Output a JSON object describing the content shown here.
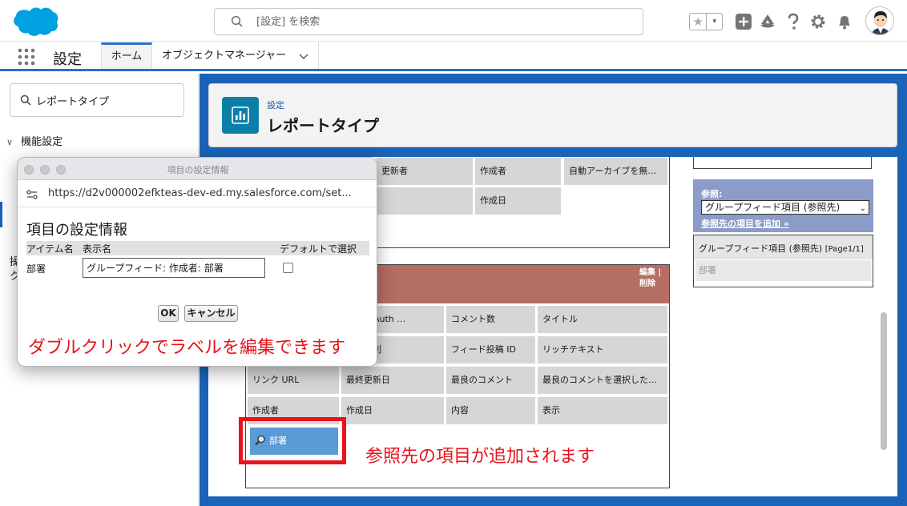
{
  "header": {
    "search_placeholder": "[設定] を検索",
    "fav_star": "★",
    "fav_caret": "▾"
  },
  "context_bar": {
    "app_name": "設定",
    "tabs": [
      {
        "label": "ホーム"
      },
      {
        "label": "オブジェクトマネージャー"
      }
    ]
  },
  "left_nav": {
    "search_value": "レポートタイプ",
    "section": "機能設定",
    "section_arrow": "∨",
    "stub_1": "操",
    "stub_2": "ク"
  },
  "page_header": {
    "breadcrumb": "設定",
    "title": "レポートタイプ"
  },
  "upper_table": {
    "cells": [
      {
        "label": "更新者"
      },
      {
        "label": "作成者"
      },
      {
        "label": "自動アーカイブを無効化"
      },
      {
        "label": "作成日"
      }
    ]
  },
  "lower_table": {
    "actions": "編集 | 削除",
    "rows": [
      [
        "ント OAuth …",
        "コメント数",
        "タイトル"
      ],
      [
        "項目種別",
        "フィード投稿 ID",
        "リッチテキスト"
      ],
      [
        "リンク URL",
        "最終更新日",
        "最良のコメント",
        "最良のコメントを選択したユ…"
      ],
      [
        "作成者",
        "作成日",
        "内容",
        "表示"
      ]
    ],
    "added_field": "部署"
  },
  "right_panel": {
    "ref_label": "参照:",
    "ref_selected": "グループフィード項目 (参照先)",
    "ref_link": "参照先の項目を追加 »",
    "group_title": "グループフィード項目 (参照先)",
    "group_page": "[Page1/1]",
    "group_item": "部署"
  },
  "popup": {
    "window_title": "項目の設定情報",
    "url": "https://d2v000002efkteas-dev-ed.my.salesforce.com/set...",
    "heading": "項目の設定情報",
    "col_item": "アイテム名",
    "col_display": "表示名",
    "col_default": "デフォルトで選択",
    "row_item": "部署",
    "row_display_value": "グループフィード: 作成者: 部署",
    "ok_label": "OK",
    "cancel_label": "キャンセル"
  },
  "annotations": {
    "popup_note": "ダブルクリックでラベルを編集できます",
    "added_note": "参照先の項目が追加されます"
  },
  "colors": {
    "brand_blue": "#1a63b8",
    "salesforce_cloud": "#00a1e0",
    "section_header": "#b46e63",
    "ref_panel": "#8a9cc7",
    "annotation_red": "#e8131b"
  }
}
